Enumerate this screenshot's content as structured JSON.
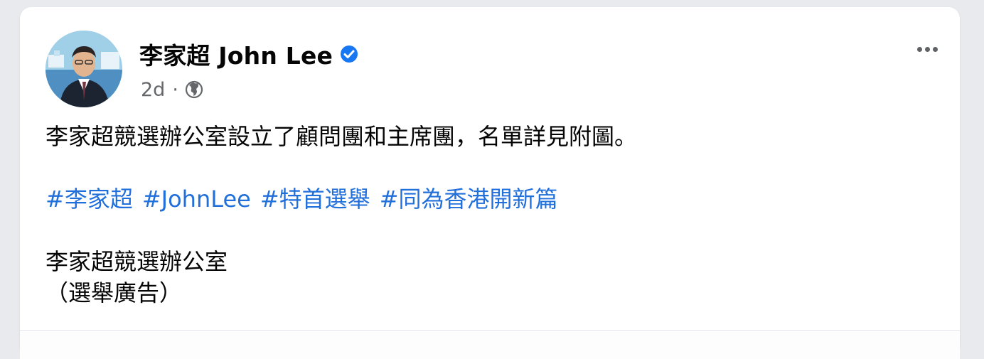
{
  "post": {
    "author": "李家超 John Lee",
    "verified": true,
    "timestamp": "2d",
    "separator": "·",
    "privacy_icon": "globe-icon",
    "more_icon": "more-options-icon",
    "text_line_1": "李家超競選辦公室設立了顧問團和主席團，名單詳見附圖。",
    "hashtags": [
      "#李家超",
      "#JohnLee",
      "#特首選舉",
      "#同為香港開新篇"
    ],
    "text_line_2": "李家超競選辦公室",
    "text_line_3": "（選舉廣告）"
  },
  "colors": {
    "page_bg": "#e9eaed",
    "card_bg": "#ffffff",
    "text": "#050505",
    "secondary_text": "#65676b",
    "hashtag": "#216fdb",
    "verified_badge": "#1877f2"
  }
}
